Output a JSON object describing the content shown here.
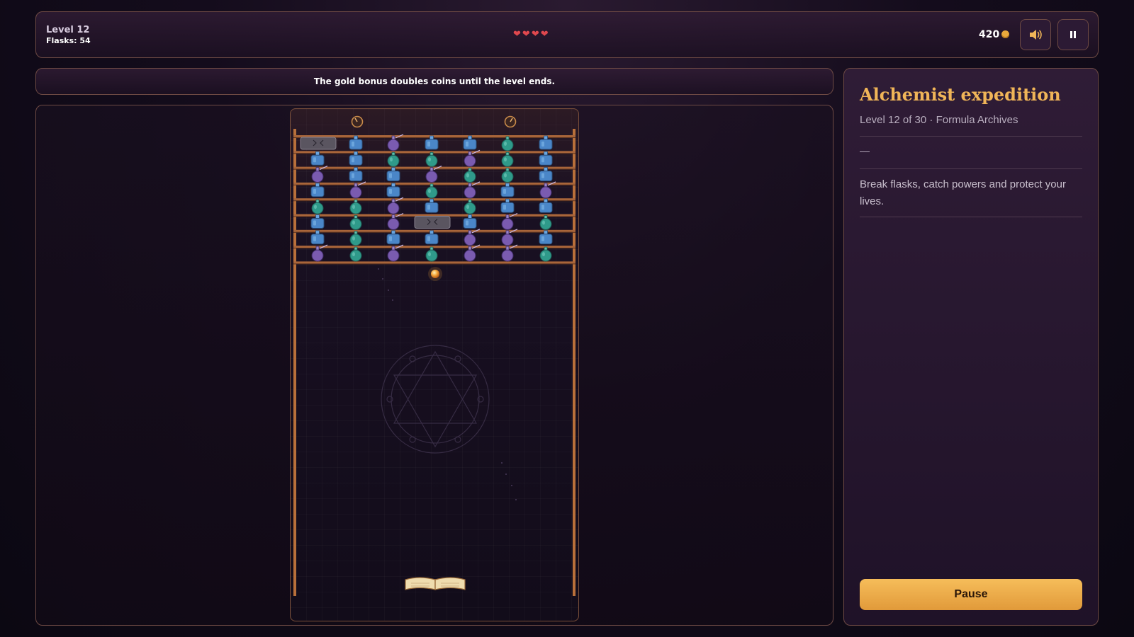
{
  "hud": {
    "level_label": "Level 12",
    "flasks_label": "Flasks: 54",
    "lives": 4,
    "coins": "420",
    "colors": {
      "heart": "#e0484e",
      "coin": "#e9a83c"
    }
  },
  "notice": "The gold bonus doubles coins until the level ends.",
  "sidebar": {
    "title": "Alchemist expedition",
    "subtitle": "Level 12 of 30 · Formula Archives",
    "status": "—",
    "description": "Break flasks, catch powers and protect your lives.",
    "pause_label": "Pause",
    "colors": {
      "title": "#f0b558",
      "button": "#eaa846"
    }
  },
  "game": {
    "icons": [
      "timer-icon",
      "timer-icon",
      "ball",
      "book-paddle",
      "magic-circle"
    ],
    "grid": [
      [
        "stone",
        "blue",
        "purple",
        "blue",
        "blue",
        "teal",
        "blue"
      ],
      [
        "blue",
        "blue",
        "teal",
        "teal",
        "purple",
        "teal",
        "blue"
      ],
      [
        "purple",
        "blue",
        "blue",
        "purple",
        "teal",
        "teal",
        "blue"
      ],
      [
        "blue",
        "purple",
        "blue",
        "teal",
        "purple",
        "blue",
        "purple"
      ],
      [
        "teal",
        "teal",
        "purple",
        "blue",
        "teal",
        "blue",
        "blue"
      ],
      [
        "blue",
        "teal",
        "purple",
        "stone",
        "blue",
        "purple",
        "teal"
      ],
      [
        "blue",
        "teal",
        "blue",
        "blue",
        "purple",
        "purple",
        "blue"
      ],
      [
        "purple",
        "teal",
        "purple",
        "teal",
        "purple",
        "purple",
        "teal"
      ]
    ],
    "flask_colors": {
      "blue": "#4a86c8",
      "purple": "#7a5bb0",
      "teal": "#2f9a8a",
      "stone": "#5a5560"
    }
  }
}
